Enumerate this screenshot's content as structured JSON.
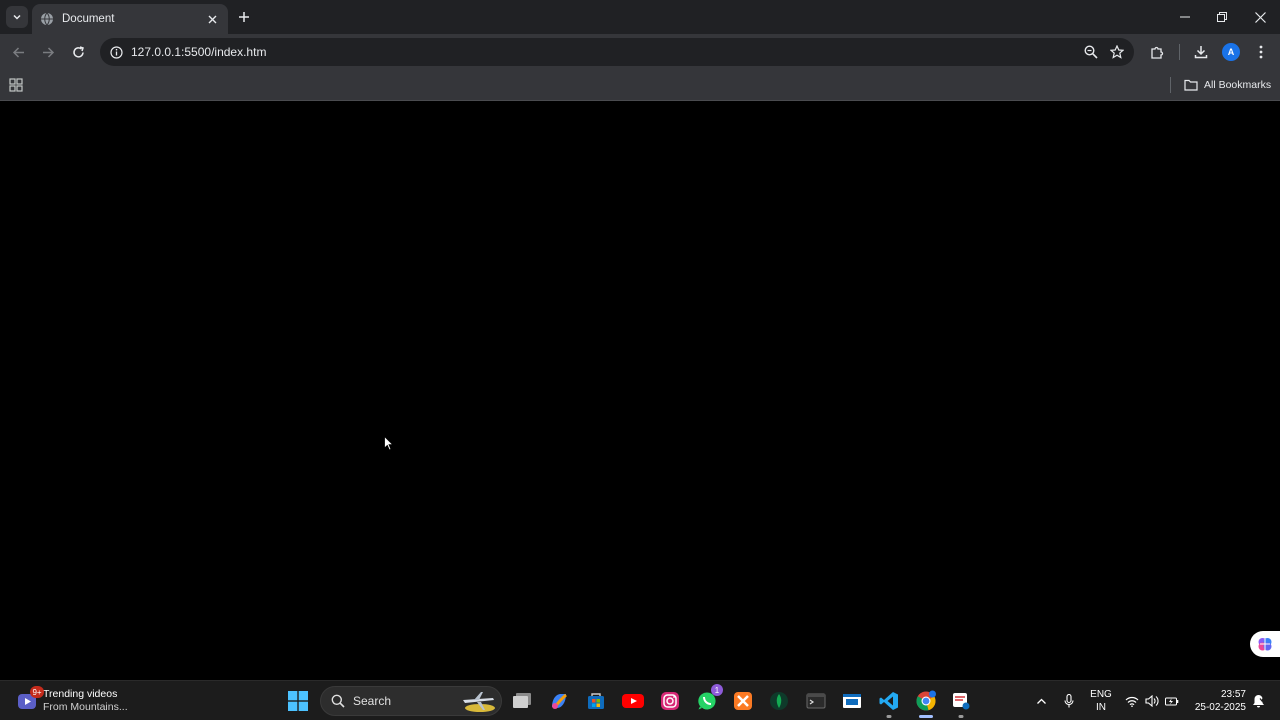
{
  "browser": {
    "tab": {
      "title": "Document"
    },
    "address_bar": {
      "url": "127.0.0.1:5500/index.htm"
    },
    "bookmarks_bar": {
      "all_bookmarks_label": "All Bookmarks"
    },
    "profile_initial": "A"
  },
  "taskbar": {
    "widget": {
      "badge": "9+",
      "line1": "Trending videos",
      "line2": "From Mountains..."
    },
    "search_label": "Search",
    "whatsapp_badge": "1",
    "language": {
      "line1": "ENG",
      "line2": "IN"
    },
    "clock": {
      "time": "23:57",
      "date": "25-02-2025"
    }
  },
  "colors": {
    "tabstrip_bg": "#202124",
    "toolbar_bg": "#35363a",
    "page_bg": "#000000",
    "taskbar_bg": "#1c1c1c",
    "accent_blue": "#1a73e8"
  }
}
